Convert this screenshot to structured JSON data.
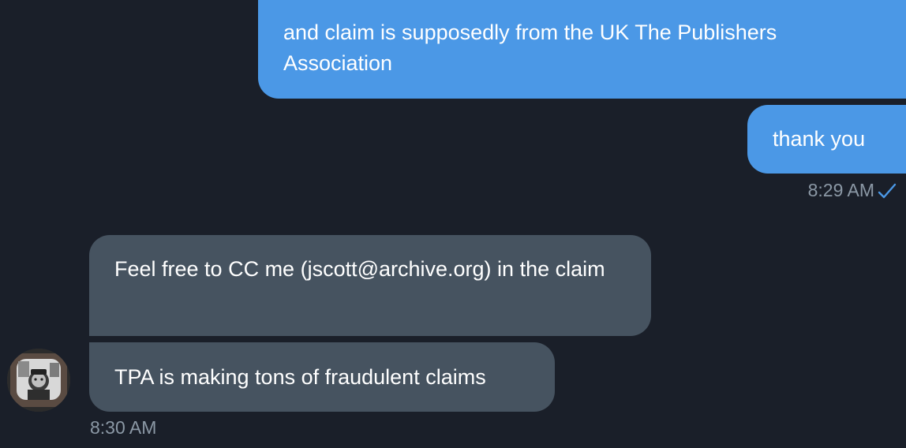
{
  "conversation": {
    "messages": [
      {
        "direction": "outgoing",
        "text": "and claim is supposedly from the UK The Publishers Association"
      },
      {
        "direction": "outgoing",
        "text": "thank you"
      },
      {
        "direction": "incoming",
        "text": "Feel free to CC me (jscott@archive.org) in the claim"
      },
      {
        "direction": "incoming",
        "text": "TPA is making tons of fraudulent claims"
      }
    ],
    "outgoing_timestamp": "8:29 AM",
    "incoming_timestamp": "8:30 AM",
    "read_status_icon": "checkmark-icon"
  },
  "colors": {
    "background": "#1a1f29",
    "outgoing_bubble": "#4b98e6",
    "incoming_bubble": "#465360",
    "timestamp": "#8b98a5",
    "checkmark": "#4b98e6"
  }
}
